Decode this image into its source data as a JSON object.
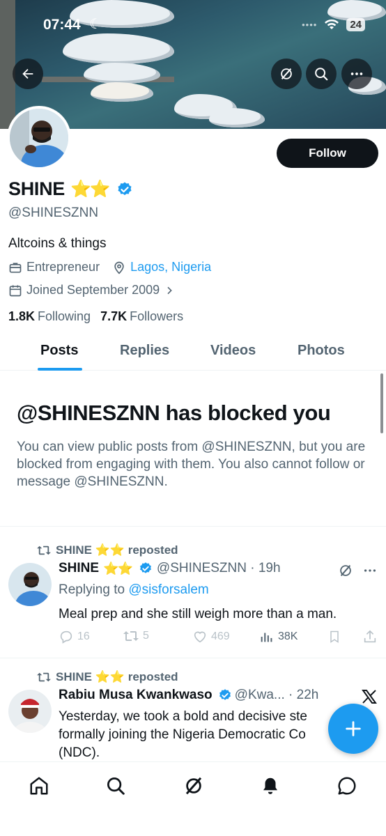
{
  "status_bar": {
    "time": "07:44",
    "battery": "24"
  },
  "profile": {
    "name": "SHINE",
    "stars": "⭐⭐",
    "handle": "@SHINESZNN",
    "bio": "Altcoins & things",
    "category": "Entrepreneur",
    "location": "Lagos, Nigeria",
    "joined": "Joined September 2009",
    "following_count": "1.8K",
    "following_label": "Following",
    "followers_count": "7.7K",
    "followers_label": "Followers",
    "follow_button": "Follow"
  },
  "tabs": [
    {
      "label": "Posts",
      "active": true
    },
    {
      "label": "Replies",
      "active": false
    },
    {
      "label": "Videos",
      "active": false
    },
    {
      "label": "Photos",
      "active": false
    }
  ],
  "blocked": {
    "title": "@SHINESZNN has blocked you",
    "description": "You can view public posts from @SHINESZNN, but you are blocked from engaging with them. You also cannot follow or message @SHINESZNN."
  },
  "posts": [
    {
      "repost_label": "SHINE ⭐⭐ reposted",
      "author": "SHINE",
      "stars": "⭐⭐",
      "handle_time": "@SHINESZNN · 19h",
      "replying_prefix": "Replying to",
      "replying_to": "@sisforsalem",
      "text": "Meal prep and she still weigh more than a man.",
      "replies": "16",
      "reposts": "5",
      "likes": "469",
      "views": "38K"
    },
    {
      "repost_label": "SHINE ⭐⭐ reposted",
      "author": "Rabiu Musa Kwankwaso",
      "handle_time": "@Kwa... · 22h",
      "text_line1": "Yesterday, we took a bold and decisive ste",
      "text_line2": "formally joining the Nigeria Democratic Co",
      "text_line3": "(NDC)."
    }
  ],
  "colors": {
    "accent": "#1d9bf0",
    "text": "#0f1419",
    "muted": "#536471"
  }
}
